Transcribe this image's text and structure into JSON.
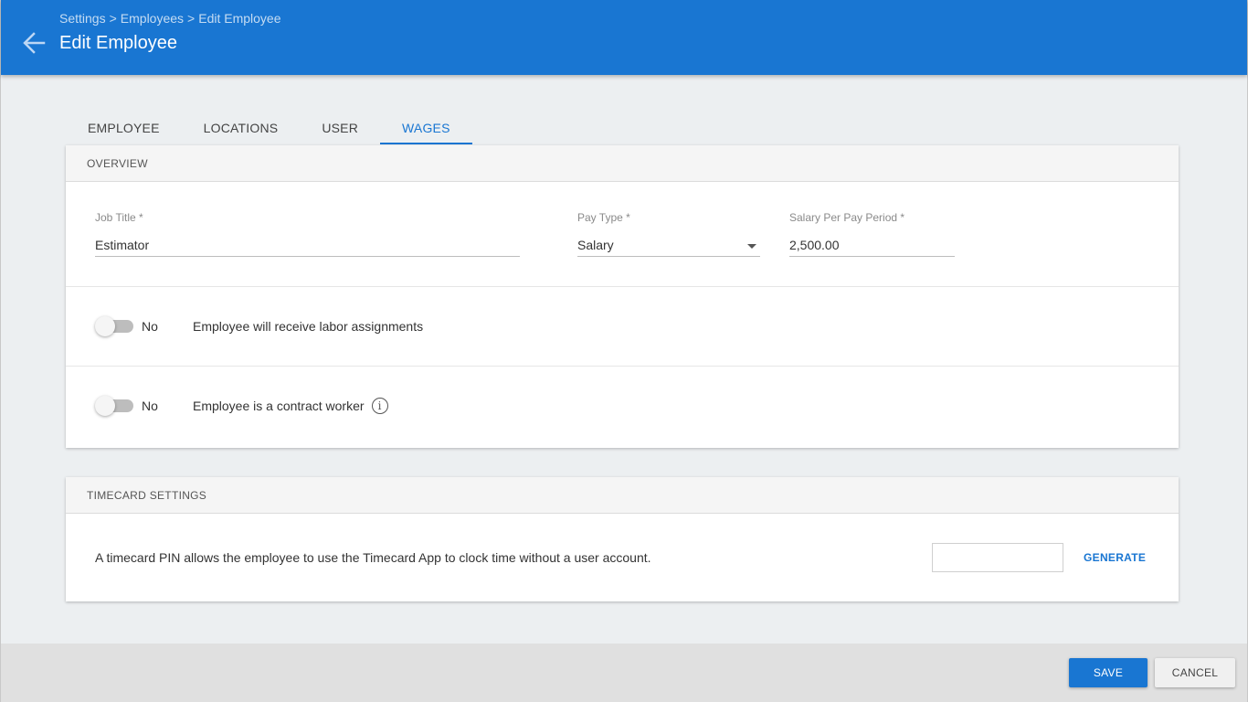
{
  "header": {
    "breadcrumbs": [
      "Settings",
      "Employees",
      "Edit Employee"
    ],
    "separator": ">",
    "title": "Edit Employee"
  },
  "tabs": [
    {
      "label": "EMPLOYEE",
      "active": false
    },
    {
      "label": "LOCATIONS",
      "active": false
    },
    {
      "label": "USER",
      "active": false
    },
    {
      "label": "WAGES",
      "active": true
    }
  ],
  "overview": {
    "section_title": "OVERVIEW",
    "job_title": {
      "label": "Job Title *",
      "value": "Estimator"
    },
    "pay_type": {
      "label": "Pay Type *",
      "value": "Salary"
    },
    "salary": {
      "label": "Salary Per Pay Period *",
      "value": "2,500.00"
    },
    "labor_toggle": {
      "state": "No",
      "description": "Employee will receive labor assignments"
    },
    "contract_toggle": {
      "state": "No",
      "description": "Employee is a contract worker",
      "info_glyph": "i"
    }
  },
  "timecard": {
    "section_title": "TIMECARD SETTINGS",
    "description": "A timecard PIN allows the employee to use the Timecard App to clock time without a user account.",
    "pin_value": "",
    "generate_label": "GENERATE"
  },
  "footer": {
    "save_label": "SAVE",
    "cancel_label": "CANCEL"
  },
  "colors": {
    "primary": "#1976d2",
    "background": "#eceff1"
  }
}
